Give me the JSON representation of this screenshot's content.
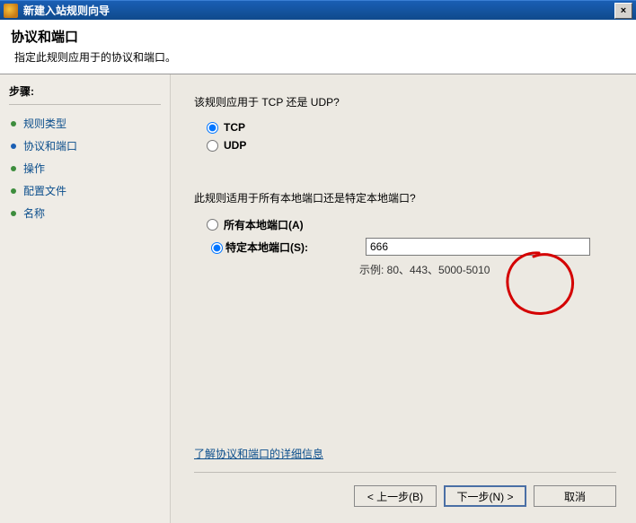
{
  "titlebar": {
    "title": "新建入站规则向导",
    "close_label": "×"
  },
  "header": {
    "title": "协议和端口",
    "subtitle": "指定此规则应用于的协议和端口。"
  },
  "sidebar": {
    "steps_label": "步骤:",
    "items": [
      {
        "label": "规则类型"
      },
      {
        "label": "协议和端口"
      },
      {
        "label": "操作"
      },
      {
        "label": "配置文件"
      },
      {
        "label": "名称"
      }
    ]
  },
  "main": {
    "q1": "该规则应用于 TCP 还是 UDP?",
    "tcp_label": "TCP",
    "udp_label": "UDP",
    "q2": "此规则适用于所有本地端口还是特定本地端口?",
    "all_ports_label": "所有本地端口(A)",
    "specific_ports_label": "特定本地端口(S):",
    "port_value": "666",
    "example_text": "示例: 80、443、5000-5010",
    "help_link": "了解协议和端口的详细信息"
  },
  "footer": {
    "back": "< 上一步(B)",
    "next": "下一步(N) >",
    "cancel": "取消"
  }
}
